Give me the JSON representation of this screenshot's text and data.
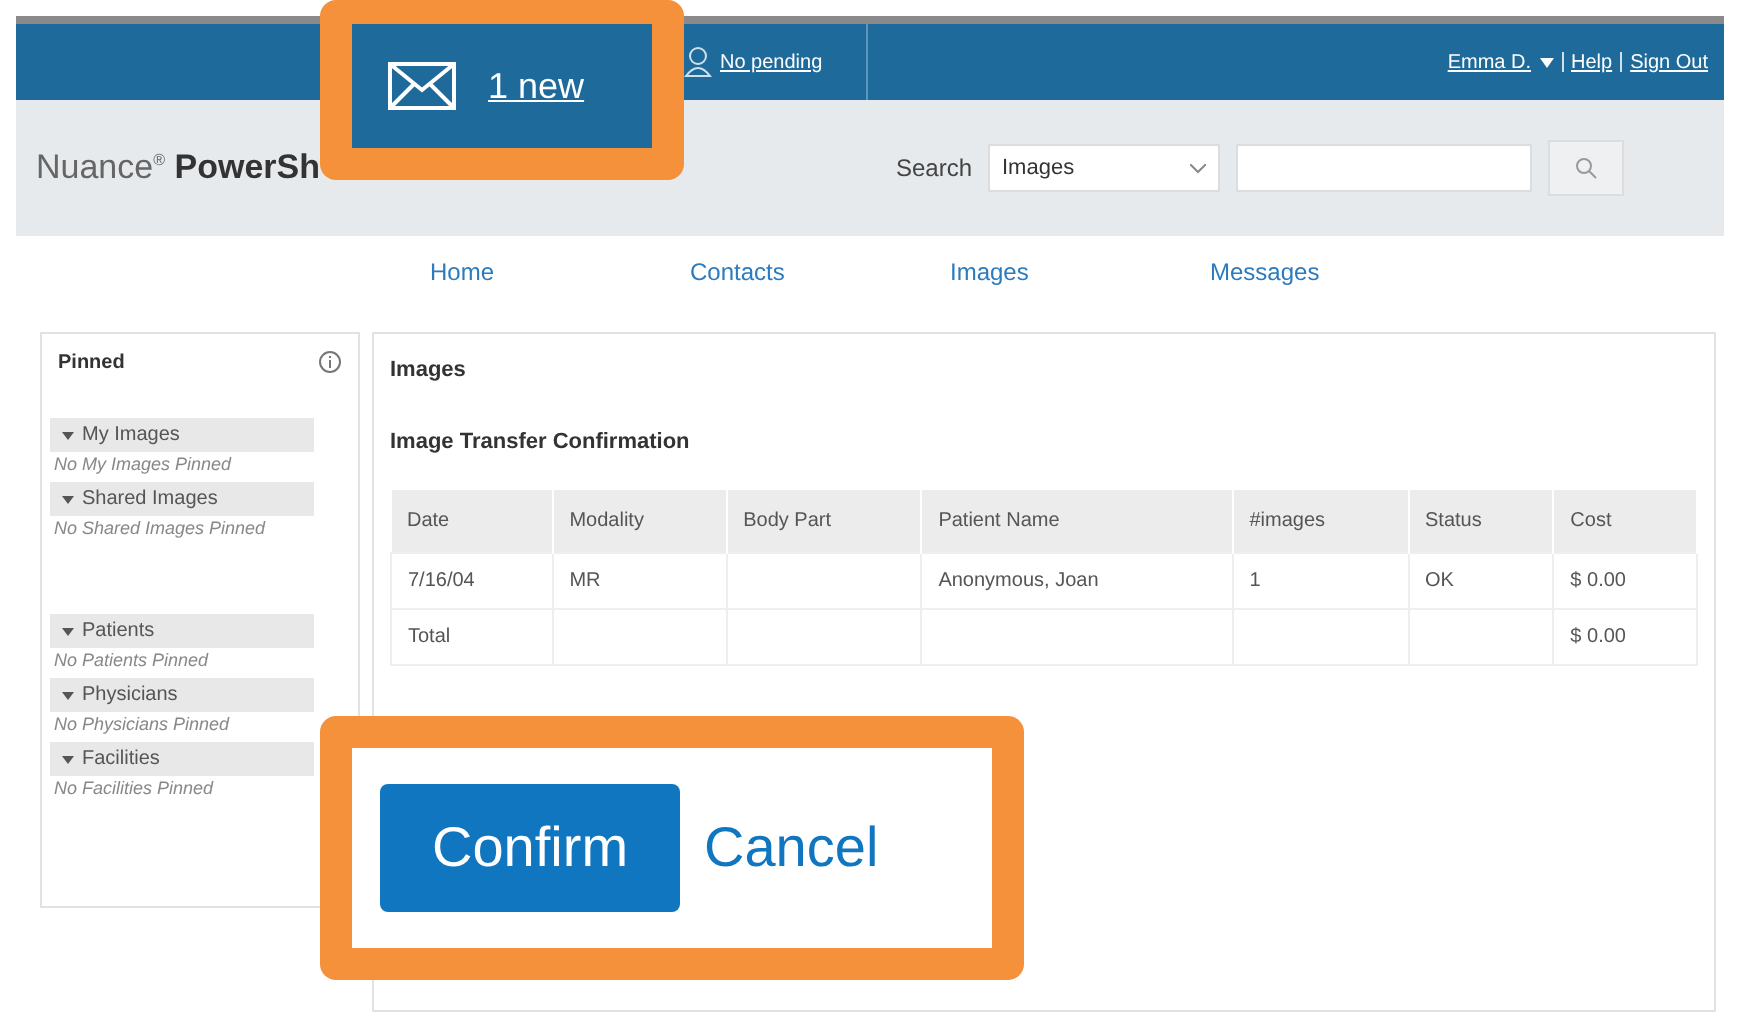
{
  "top_bar": {
    "pending_link": "No pending",
    "user_menu": "Emma D.",
    "links": [
      "Help",
      "Sign Out"
    ]
  },
  "header": {
    "logo_brand": "Nuance",
    "logo_mark": "®",
    "logo_product": "PowerSh",
    "search_label": "Search",
    "search_scope": "Images"
  },
  "nav": [
    {
      "label": "Home"
    },
    {
      "label": "Contacts"
    },
    {
      "label": "Images"
    },
    {
      "label": "Messages"
    }
  ],
  "sidebar": {
    "title": "Pinned",
    "sections": [
      {
        "label": "My Images",
        "empty_text": "No My Images Pinned"
      },
      {
        "label": "Shared Images",
        "empty_text": "No Shared Images Pinned"
      },
      {
        "label": "Patients",
        "empty_text": "No Patients Pinned"
      },
      {
        "label": "Physicians",
        "empty_text": "No Physicians Pinned"
      },
      {
        "label": "Facilities",
        "empty_text": "No Facilities Pinned"
      }
    ]
  },
  "content": {
    "title": "Images",
    "subtitle": "Image Transfer Confirmation",
    "table": {
      "columns": [
        "Date",
        "Modality",
        "Body Part",
        "Patient Name",
        "#images",
        "Status",
        "Cost"
      ],
      "rows": [
        [
          "7/16/04",
          "MR",
          "",
          "Anonymous, Joan",
          "1",
          "OK",
          "$ 0.00"
        ],
        [
          "Total",
          "",
          "",
          "",
          "",
          "",
          "$ 0.00"
        ]
      ]
    }
  },
  "callouts": [
    {
      "kind": "messages",
      "label": "1 new"
    },
    {
      "kind": "actions",
      "buttons": [
        "Confirm",
        "Cancel"
      ]
    }
  ]
}
